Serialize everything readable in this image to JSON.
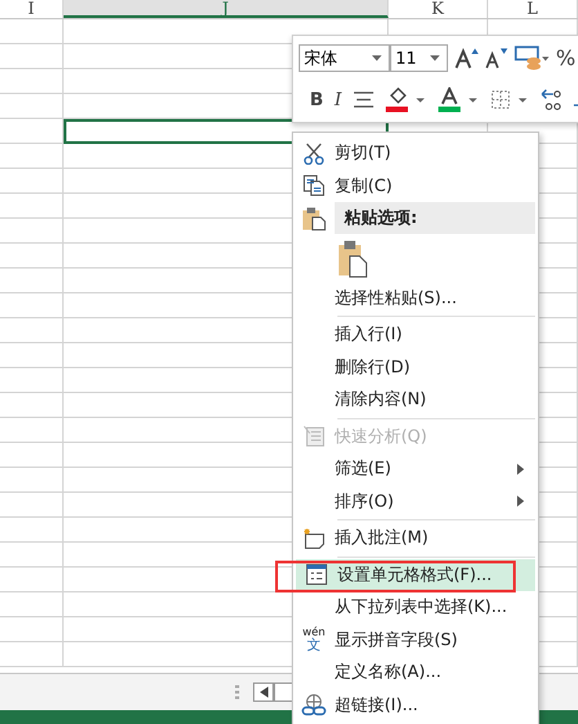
{
  "columns": [
    {
      "label": "I",
      "selected": false
    },
    {
      "label": "J",
      "selected": true
    },
    {
      "label": "K",
      "selected": false
    },
    {
      "label": "L",
      "selected": false
    }
  ],
  "mini_toolbar": {
    "font_name": "宋体",
    "font_size": "11",
    "bold_label": "B",
    "italic_label": "I",
    "percent_label": "%"
  },
  "menu": [
    {
      "kind": "item",
      "label": "剪切(T)",
      "disabled": false,
      "submenu": false,
      "selected": false
    },
    {
      "kind": "item",
      "label": "复制(C)",
      "disabled": false,
      "submenu": false,
      "selected": false
    },
    {
      "kind": "header",
      "label": "粘贴选项:"
    },
    {
      "kind": "paste_options"
    },
    {
      "kind": "item",
      "label": "选择性粘贴(S)...",
      "disabled": false,
      "submenu": false,
      "selected": false
    },
    {
      "kind": "separator"
    },
    {
      "kind": "item",
      "label": "插入行(I)",
      "disabled": false,
      "submenu": false,
      "selected": false
    },
    {
      "kind": "item",
      "label": "删除行(D)",
      "disabled": false,
      "submenu": false,
      "selected": false
    },
    {
      "kind": "item",
      "label": "清除内容(N)",
      "disabled": false,
      "submenu": false,
      "selected": false
    },
    {
      "kind": "separator"
    },
    {
      "kind": "item",
      "label": "快速分析(Q)",
      "disabled": true,
      "submenu": false,
      "selected": false
    },
    {
      "kind": "item",
      "label": "筛选(E)",
      "disabled": false,
      "submenu": true,
      "selected": false
    },
    {
      "kind": "item",
      "label": "排序(O)",
      "disabled": false,
      "submenu": true,
      "selected": false
    },
    {
      "kind": "separator"
    },
    {
      "kind": "item",
      "label": "插入批注(M)",
      "disabled": false,
      "submenu": false,
      "selected": false
    },
    {
      "kind": "separator"
    },
    {
      "kind": "item",
      "label": "设置单元格格式(F)...",
      "disabled": false,
      "submenu": false,
      "selected": true
    },
    {
      "kind": "item",
      "label": "从下拉列表中选择(K)...",
      "disabled": false,
      "submenu": false,
      "selected": false
    },
    {
      "kind": "item",
      "label": "显示拼音字段(S)",
      "disabled": false,
      "submenu": false,
      "selected": false,
      "icon_text": [
        "wén",
        "文"
      ]
    },
    {
      "kind": "item",
      "label": "定义名称(A)...",
      "disabled": false,
      "submenu": false,
      "selected": false
    },
    {
      "kind": "item",
      "label": "超链接(I)...",
      "disabled": false,
      "submenu": false,
      "selected": false
    }
  ]
}
